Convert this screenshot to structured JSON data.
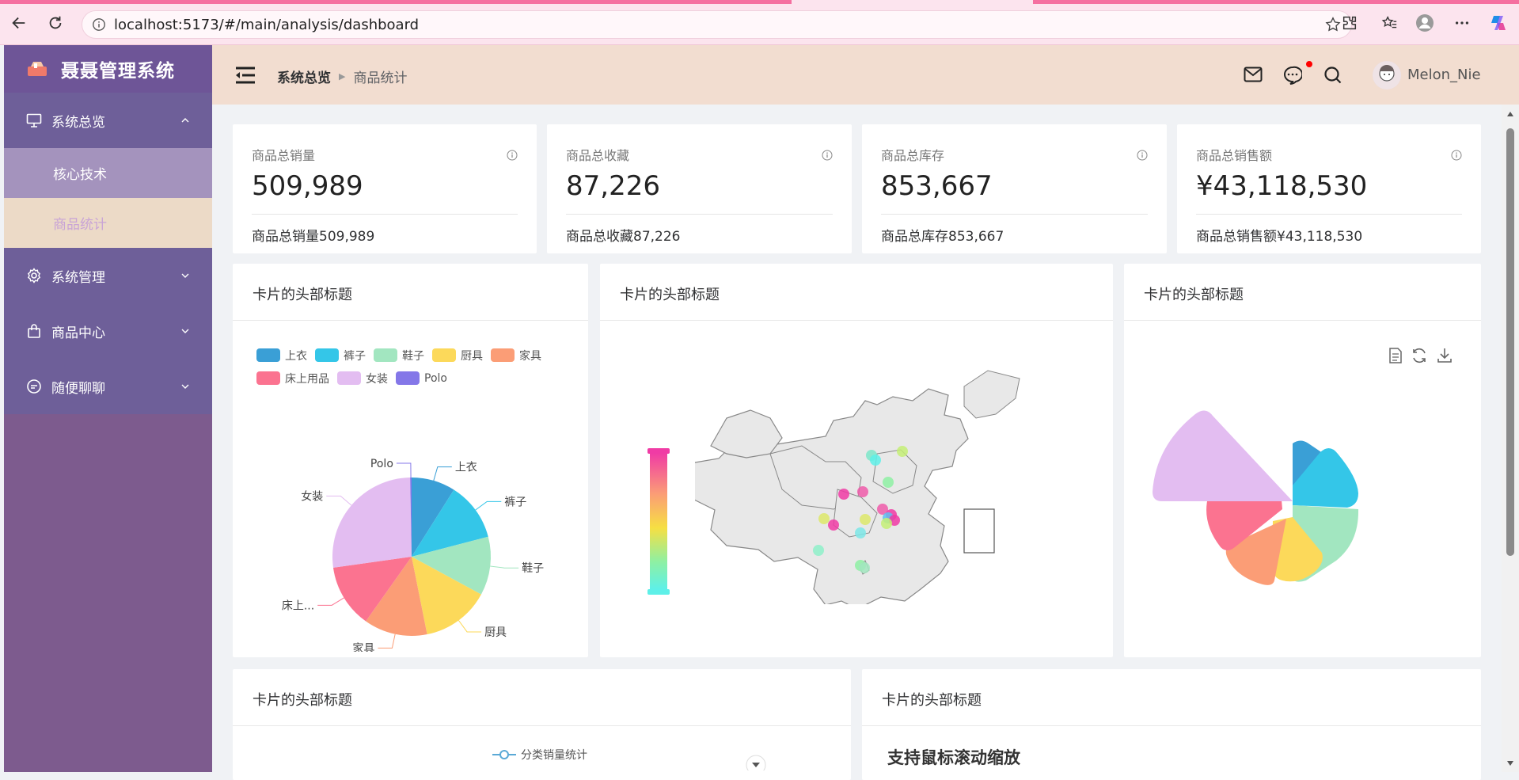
{
  "browser": {
    "url": "localhost:5173/#/main/analysis/dashboard"
  },
  "sidebar": {
    "brand": "聂聂管理系统",
    "menus": [
      {
        "label": "系统总览",
        "icon": "monitor-icon"
      },
      {
        "label": "系统管理",
        "icon": "gear-icon"
      },
      {
        "label": "商品中心",
        "icon": "bag-icon"
      },
      {
        "label": "随便聊聊",
        "icon": "chat-icon"
      }
    ],
    "sub_items": [
      "核心技术",
      "商品统计"
    ]
  },
  "header": {
    "breadcrumb": [
      "系统总览",
      "商品统计"
    ],
    "username": "Melon_Nie"
  },
  "stats": [
    {
      "title": "商品总销量",
      "value": "509,989",
      "footer": "商品总销量509,989"
    },
    {
      "title": "商品总收藏",
      "value": "87,226",
      "footer": "商品总收藏87,226"
    },
    {
      "title": "商品总库存",
      "value": "853,667",
      "footer": "商品总库存853,667"
    },
    {
      "title": "商品总销售额",
      "value": "¥43,118,530",
      "footer": "商品总销售额¥43,118,530"
    }
  ],
  "cards": {
    "pie_title": "卡片的头部标题",
    "map_title": "卡片的头部标题",
    "rose_title": "卡片的头部标题",
    "line_title": "卡片的头部标题",
    "bar_title": "卡片的头部标题",
    "line_legend": "分类销量统计",
    "bar_subtitle": "支持鼠标滚动缩放"
  },
  "colors": {
    "上衣": "#3a9fd6",
    "裤子": "#34c6e8",
    "鞋子": "#a2e6c0",
    "厨具": "#fcd95a",
    "家具": "#fb9d76",
    "床上用品": "#fb7390",
    "女装": "#e3bdf1",
    "Polo": "#8477e8"
  },
  "chart_data": {
    "type": "pie",
    "legend": [
      "上衣",
      "裤子",
      "鞋子",
      "厨具",
      "家具",
      "床上用品",
      "女装",
      "Polo"
    ],
    "labels": [
      "上衣",
      "裤子",
      "鞋子",
      "厨具",
      "家具",
      "床上...",
      "女装",
      "Polo"
    ],
    "values": [
      9,
      12,
      12,
      14,
      13,
      13,
      27,
      0.3
    ]
  }
}
